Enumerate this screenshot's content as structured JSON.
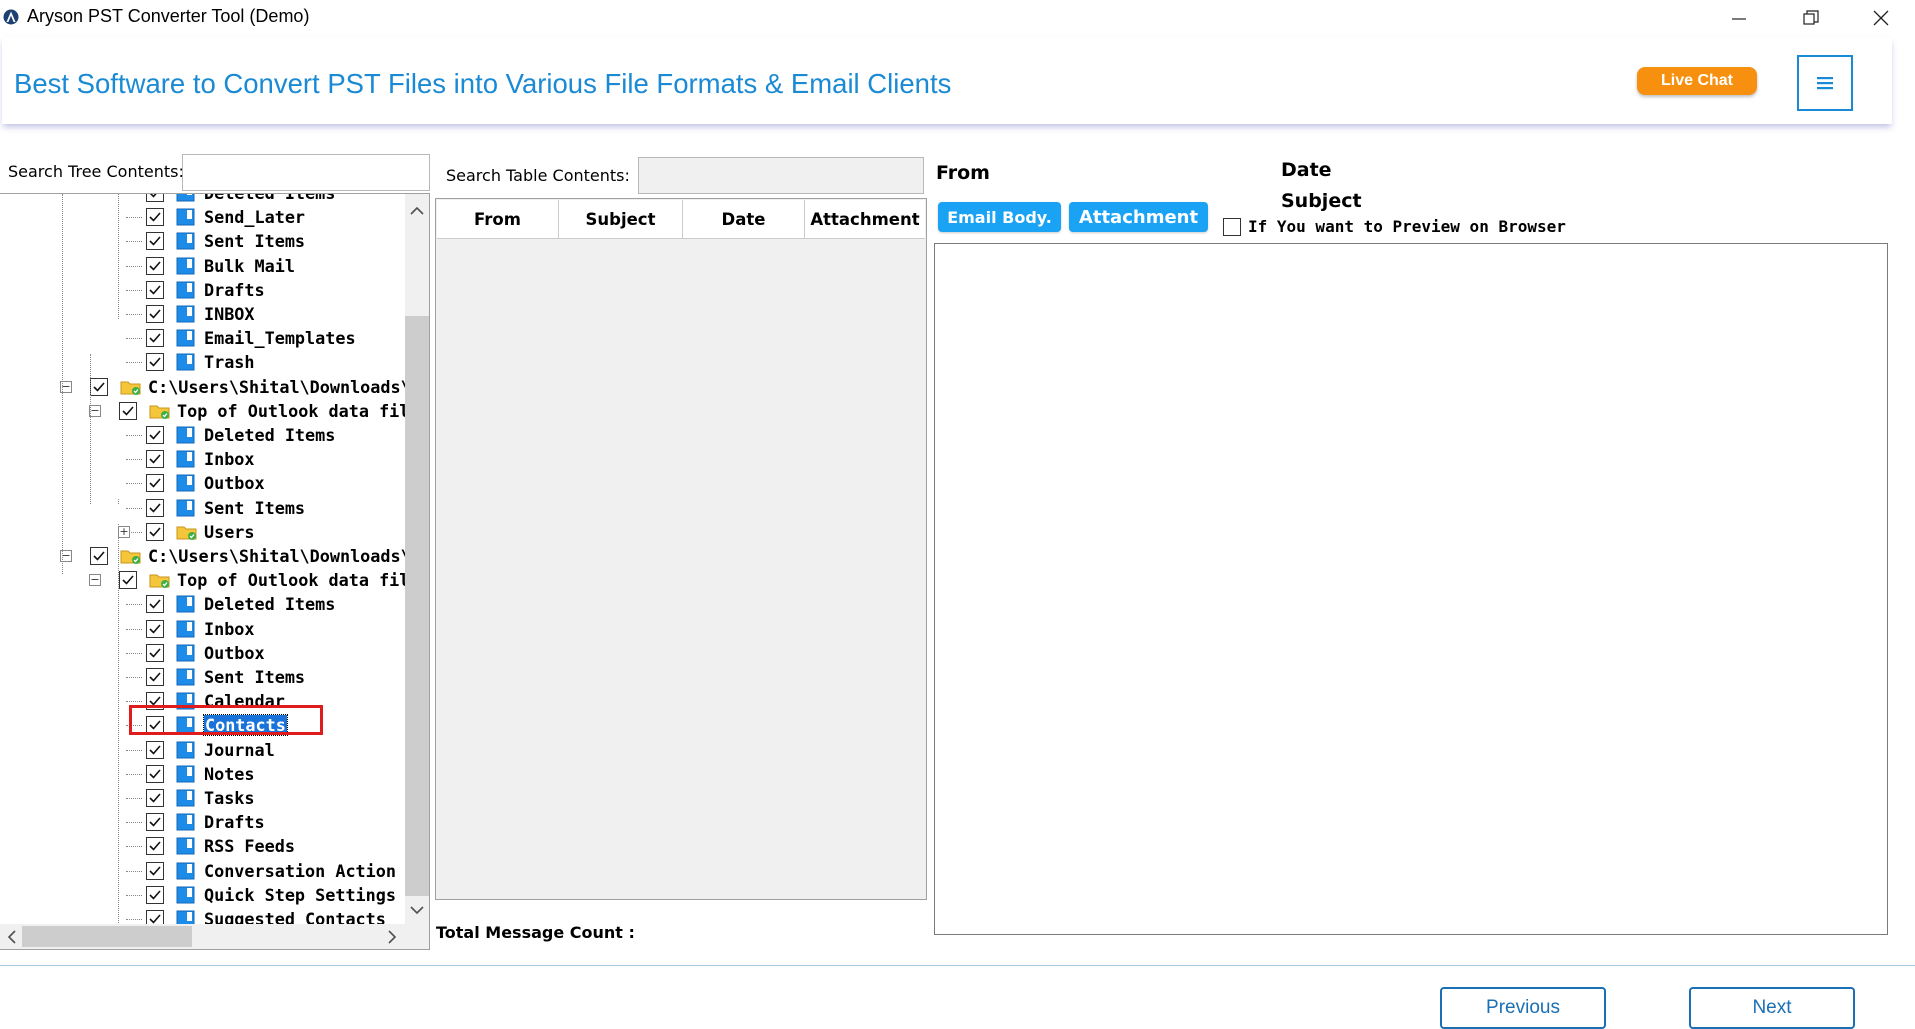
{
  "window": {
    "title": "Aryson PST Converter Tool (Demo)",
    "minimize_glyph": "—",
    "maximize_glyph": "❐",
    "close_glyph": "✕"
  },
  "header": {
    "title": "Best Software to Convert PST Files into Various File Formats & Email Clients",
    "live_chat_label": "Live Chat",
    "menu_glyph": "≡",
    "accent_color": "#1a8ad4",
    "live_chat_color": "#f7900e"
  },
  "tree": {
    "search_label": "Search Tree Contents:",
    "search_value": "",
    "rows": [
      {
        "label": "Deleted Items",
        "depth": 2,
        "icon": "folder-blue-icon",
        "partial": true
      },
      {
        "label": "Send_Later",
        "depth": 2,
        "icon": "folder-blue-icon"
      },
      {
        "label": "Sent Items",
        "depth": 2,
        "icon": "folder-blue-icon"
      },
      {
        "label": "Bulk Mail",
        "depth": 2,
        "icon": "folder-blue-icon"
      },
      {
        "label": "Drafts",
        "depth": 2,
        "icon": "folder-blue-icon"
      },
      {
        "label": "INBOX",
        "depth": 2,
        "icon": "folder-blue-icon"
      },
      {
        "label": "Email_Templates",
        "depth": 2,
        "icon": "folder-blue-icon"
      },
      {
        "label": "Trash",
        "depth": 2,
        "icon": "folder-blue-icon"
      },
      {
        "label": "C:\\Users\\Shital\\Downloads\\a",
        "depth": 0,
        "icon": "pst-file-icon",
        "expander": "−"
      },
      {
        "label": "Top of Outlook data file",
        "depth": 1,
        "icon": "pst-file-icon",
        "expander": "−"
      },
      {
        "label": "Deleted Items",
        "depth": 2,
        "icon": "folder-blue-icon"
      },
      {
        "label": "Inbox",
        "depth": 2,
        "icon": "folder-blue-icon"
      },
      {
        "label": "Outbox",
        "depth": 2,
        "icon": "folder-blue-icon"
      },
      {
        "label": "Sent Items",
        "depth": 2,
        "icon": "folder-blue-icon"
      },
      {
        "label": "Users",
        "depth": 2,
        "icon": "pst-file-icon",
        "expander": "+"
      },
      {
        "label": "C:\\Users\\Shital\\Downloads\\a",
        "depth": 0,
        "icon": "pst-file-icon",
        "expander": "−"
      },
      {
        "label": "Top of Outlook data file",
        "depth": 1,
        "icon": "pst-file-icon",
        "expander": "−"
      },
      {
        "label": "Deleted Items",
        "depth": 2,
        "icon": "folder-blue-icon"
      },
      {
        "label": "Inbox",
        "depth": 2,
        "icon": "folder-blue-icon"
      },
      {
        "label": "Outbox",
        "depth": 2,
        "icon": "folder-blue-icon"
      },
      {
        "label": "Sent Items",
        "depth": 2,
        "icon": "folder-blue-icon"
      },
      {
        "label": "Calendar",
        "depth": 2,
        "icon": "folder-blue-icon"
      },
      {
        "label": "Contacts",
        "depth": 2,
        "icon": "folder-blue-icon",
        "selected": true
      },
      {
        "label": "Journal",
        "depth": 2,
        "icon": "folder-blue-icon"
      },
      {
        "label": "Notes",
        "depth": 2,
        "icon": "folder-blue-icon"
      },
      {
        "label": "Tasks",
        "depth": 2,
        "icon": "folder-blue-icon"
      },
      {
        "label": "Drafts",
        "depth": 2,
        "icon": "folder-blue-icon"
      },
      {
        "label": "RSS Feeds",
        "depth": 2,
        "icon": "folder-blue-icon"
      },
      {
        "label": "Conversation Action Set",
        "depth": 2,
        "icon": "folder-blue-icon"
      },
      {
        "label": "Quick Step Settings",
        "depth": 2,
        "icon": "folder-blue-icon"
      },
      {
        "label": "Suggested Contacts",
        "depth": 2,
        "icon": "folder-blue-icon"
      }
    ]
  },
  "table": {
    "search_label": "Search Table Contents:",
    "search_value": "",
    "columns": [
      "From",
      "Subject",
      "Date",
      "Attachment"
    ],
    "total_label": "Total Message Count :"
  },
  "preview": {
    "from_label": "From",
    "date_label": "Date",
    "subject_label": "Subject",
    "email_body_label": "Email Body.",
    "attachment_label": "Attachment",
    "browser_checkbox_label": "If You want to Preview on Browser",
    "browser_checked": false
  },
  "footer": {
    "previous_label": "Previous",
    "next_label": "Next"
  }
}
